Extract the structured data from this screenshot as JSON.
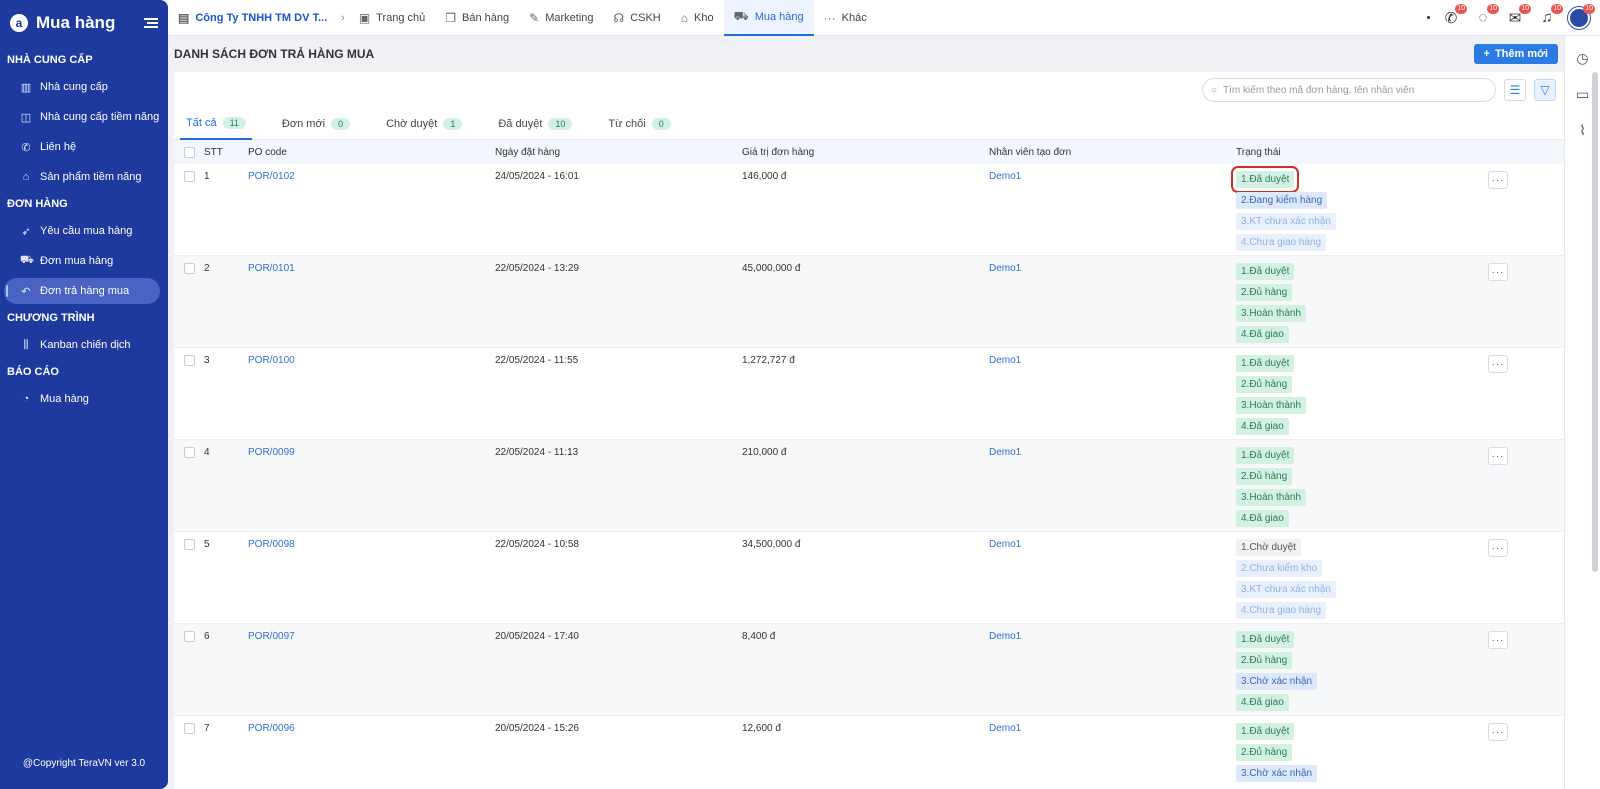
{
  "sidebar": {
    "title": "Mua hàng",
    "logo_letter": "a",
    "sections": [
      {
        "title": "NHÀ CUNG CẤP",
        "items": [
          {
            "label": "Nhà cung cấp",
            "icon": "building-icon"
          },
          {
            "label": "Nhà cung cấp tiềm năng",
            "icon": "chart-icon"
          },
          {
            "label": "Liên hệ",
            "icon": "phone-icon"
          },
          {
            "label": "Sản phẩm tiềm năng",
            "icon": "box-icon"
          }
        ]
      },
      {
        "title": "ĐƠN HÀNG",
        "items": [
          {
            "label": "Yêu cầu mua hàng",
            "icon": "rocket-icon"
          },
          {
            "label": "Đơn mua hàng",
            "icon": "cart-icon"
          },
          {
            "label": "Đơn trả hàng mua",
            "icon": "return-icon",
            "active": true
          }
        ]
      },
      {
        "title": "CHƯƠNG TRÌNH",
        "items": [
          {
            "label": "Kanban chiến dịch",
            "icon": "kanban-icon"
          }
        ]
      },
      {
        "title": "BÁO CÁO",
        "items": [
          {
            "label": "Mua hàng",
            "icon": "report-icon"
          }
        ]
      }
    ],
    "footer": "@Copyright TeraVN ver 3.0"
  },
  "topnav": {
    "company": "Công Ty TNHH TM DV T...",
    "items": [
      "Trang chủ",
      "Bán hàng",
      "Marketing",
      "CSKH",
      "Kho",
      "Mua hàng",
      "Khác"
    ],
    "active": "Mua hàng",
    "badges": [
      "10",
      "10",
      "10",
      "10",
      "10"
    ]
  },
  "page": {
    "title": "DANH SÁCH ĐƠN TRẢ HÀNG MUA",
    "add_button": "Thêm mới",
    "search_placeholder": "Tìm kiếm theo mã đơn hàng, tên nhân viên"
  },
  "tabs": [
    {
      "label": "Tất cả",
      "count": "11",
      "active": true
    },
    {
      "label": "Đơn mới",
      "count": "0"
    },
    {
      "label": "Chờ duyệt",
      "count": "1"
    },
    {
      "label": "Đã duyệt",
      "count": "10"
    },
    {
      "label": "Từ chối",
      "count": "0"
    }
  ],
  "table": {
    "headers": [
      "STT",
      "PO code",
      "Ngày đặt hàng",
      "Giá trị đơn hàng",
      "Nhân viên tạo đơn",
      "Trạng thái"
    ],
    "rows": [
      {
        "stt": "1",
        "po": "POR/0102",
        "date": "24/05/2024 - 16:01",
        "value": "146,000 đ",
        "employee": "Demo1",
        "status": [
          {
            "t": "1.Đã duyệt",
            "c": "green",
            "hl": true
          },
          {
            "t": "2.Đang kiểm hàng",
            "c": "blue"
          },
          {
            "t": "3.KT chưa xác nhận",
            "c": "lightblue"
          },
          {
            "t": "4.Chưa giao hàng",
            "c": "lightblue"
          }
        ]
      },
      {
        "stt": "2",
        "po": "POR/0101",
        "date": "22/05/2024 - 13:29",
        "value": "45,000,000 đ",
        "employee": "Demo1",
        "status": [
          {
            "t": "1.Đã duyệt",
            "c": "green"
          },
          {
            "t": "2.Đủ hàng",
            "c": "green"
          },
          {
            "t": "3.Hoàn thành",
            "c": "green"
          },
          {
            "t": "4.Đã giao",
            "c": "green"
          }
        ]
      },
      {
        "stt": "3",
        "po": "POR/0100",
        "date": "22/05/2024 - 11:55",
        "value": "1,272,727 đ",
        "employee": "Demo1",
        "status": [
          {
            "t": "1.Đã duyệt",
            "c": "green"
          },
          {
            "t": "2.Đủ hàng",
            "c": "green"
          },
          {
            "t": "3.Hoàn thành",
            "c": "green"
          },
          {
            "t": "4.Đã giao",
            "c": "green"
          }
        ]
      },
      {
        "stt": "4",
        "po": "POR/0099",
        "date": "22/05/2024 - 11:13",
        "value": "210,000 đ",
        "employee": "Demo1",
        "status": [
          {
            "t": "1.Đã duyệt",
            "c": "green"
          },
          {
            "t": "2.Đủ hàng",
            "c": "green"
          },
          {
            "t": "3.Hoàn thành",
            "c": "green"
          },
          {
            "t": "4.Đã giao",
            "c": "green"
          }
        ]
      },
      {
        "stt": "5",
        "po": "POR/0098",
        "date": "22/05/2024 - 10:58",
        "value": "34,500,000 đ",
        "employee": "Demo1",
        "status": [
          {
            "t": "1.Chờ duyệt",
            "c": "gray"
          },
          {
            "t": "2.Chưa kiểm kho",
            "c": "lightblue"
          },
          {
            "t": "3.KT chưa xác nhận",
            "c": "lightblue"
          },
          {
            "t": "4.Chưa giao hàng",
            "c": "lightblue"
          }
        ]
      },
      {
        "stt": "6",
        "po": "POR/0097",
        "date": "20/05/2024 - 17:40",
        "value": "8,400 đ",
        "employee": "Demo1",
        "status": [
          {
            "t": "1.Đã duyệt",
            "c": "green"
          },
          {
            "t": "2.Đủ hàng",
            "c": "green"
          },
          {
            "t": "3.Chờ xác nhận",
            "c": "blue"
          },
          {
            "t": "4.Đã giao",
            "c": "green"
          }
        ]
      },
      {
        "stt": "7",
        "po": "POR/0096",
        "date": "20/05/2024 - 15:26",
        "value": "12,600 đ",
        "employee": "Demo1",
        "status": [
          {
            "t": "1.Đã duyệt",
            "c": "green"
          },
          {
            "t": "2.Đủ hàng",
            "c": "green"
          },
          {
            "t": "3.Chờ xác nhận",
            "c": "blue"
          }
        ]
      }
    ],
    "more_label": "···"
  }
}
